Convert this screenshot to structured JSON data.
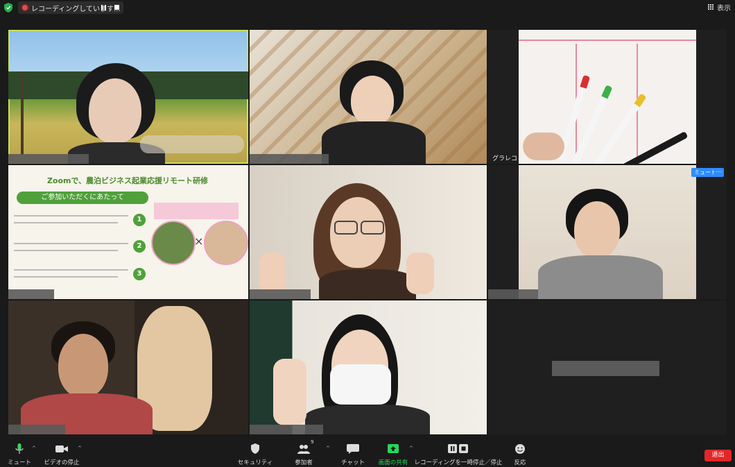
{
  "top_bar": {
    "recording_text": "レコーディングしています...",
    "view_label": "表示"
  },
  "tiles": {
    "t3_label": "グラレコ",
    "t6_mute_tag": "ミュート",
    "t6_more": "…"
  },
  "flyer": {
    "title": "Zoomで、農泊ビジネス起業応援リモート研修",
    "pill": "ご参加いただくにあたって",
    "items": [
      "1",
      "2",
      "3"
    ],
    "x_mark": "×"
  },
  "toolbar": {
    "mute": "ミュート",
    "video_stop": "ビデオの停止",
    "security": "セキュリティ",
    "participants": "参加者",
    "participants_count": "9",
    "chat": "チャット",
    "share": "画面の共有",
    "record_pause": "レコーディングを一時停止／停止",
    "reactions": "反応",
    "end": "退出"
  },
  "colors": {
    "accent_blue": "#2d8cff",
    "end_red": "#e02828",
    "share_green": "#23d959",
    "speaker_outline": "#c8e05a"
  }
}
